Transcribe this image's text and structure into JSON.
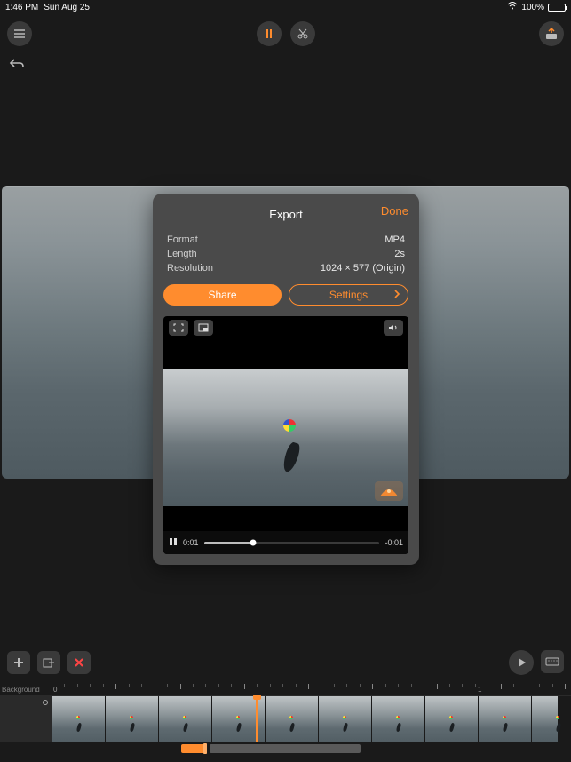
{
  "status": {
    "time": "1:46 PM",
    "date": "Sun Aug 25",
    "battery_pct": "100%"
  },
  "export": {
    "title": "Export",
    "done": "Done",
    "format_label": "Format",
    "format_value": "MP4",
    "length_label": "Length",
    "length_value": "2s",
    "resolution_label": "Resolution",
    "resolution_value": "1024 × 577 (Origin)",
    "share_label": "Share",
    "settings_label": "Settings"
  },
  "player": {
    "elapsed": "0:01",
    "remaining": "-0:01"
  },
  "timeline": {
    "bg_label": "Background",
    "ruler_start": "0",
    "ruler_end": "1"
  },
  "colors": {
    "accent": "#ff8c2e"
  }
}
